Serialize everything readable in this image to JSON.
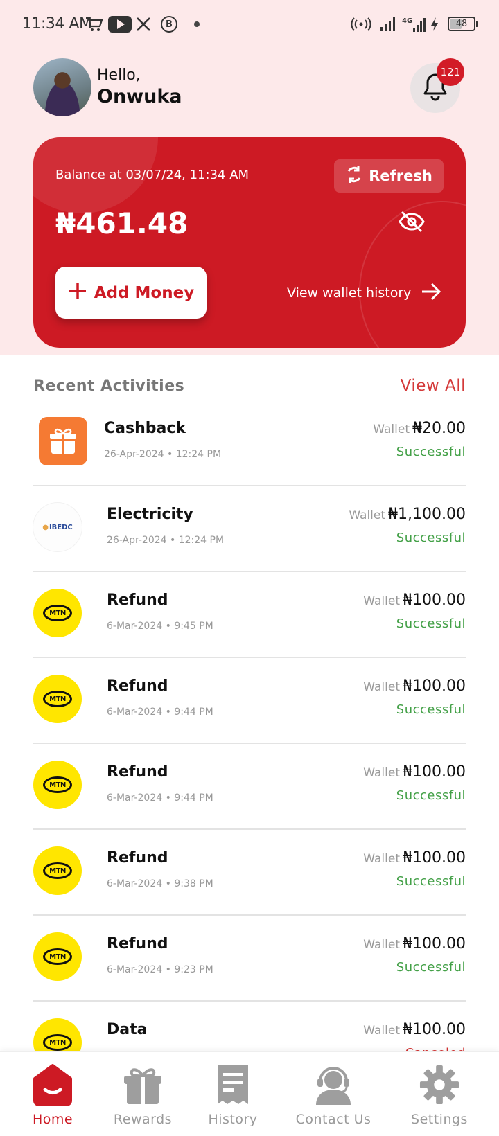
{
  "status_bar": {
    "time": "11:34 AM",
    "battery": "48",
    "network": "4G"
  },
  "header": {
    "greeting": "Hello,",
    "name": "Onwuka",
    "notification_count": "121"
  },
  "balance_card": {
    "label": "Balance at 03/07/24, 11:34 AM",
    "refresh_label": "Refresh",
    "amount": "₦461.48",
    "add_money_label": "Add Money",
    "history_link_label": "View wallet history"
  },
  "recent": {
    "title": "Recent Activities",
    "view_all_label": "View All",
    "items": [
      {
        "title": "Cashback",
        "date": "26-Apr-2024 • 12:24 PM",
        "source": "Wallet",
        "amount": "₦20.00",
        "status": "Successful",
        "logo": "gift-icon"
      },
      {
        "title": "Electricity",
        "date": "26-Apr-2024 • 12:24 PM",
        "source": "Wallet",
        "amount": "₦1,100.00",
        "status": "Successful",
        "logo": "ibedc-logo",
        "logo_text": "IBEDC"
      },
      {
        "title": "Refund",
        "date": "6-Mar-2024 • 9:45 PM",
        "source": "Wallet",
        "amount": "₦100.00",
        "status": "Successful",
        "logo": "mtn-logo",
        "logo_text": "MTN"
      },
      {
        "title": "Refund",
        "date": "6-Mar-2024 • 9:44 PM",
        "source": "Wallet",
        "amount": "₦100.00",
        "status": "Successful",
        "logo": "mtn-logo",
        "logo_text": "MTN"
      },
      {
        "title": "Refund",
        "date": "6-Mar-2024 • 9:44 PM",
        "source": "Wallet",
        "amount": "₦100.00",
        "status": "Successful",
        "logo": "mtn-logo",
        "logo_text": "MTN"
      },
      {
        "title": "Refund",
        "date": "6-Mar-2024 • 9:38 PM",
        "source": "Wallet",
        "amount": "₦100.00",
        "status": "Successful",
        "logo": "mtn-logo",
        "logo_text": "MTN"
      },
      {
        "title": "Refund",
        "date": "6-Mar-2024 • 9:23 PM",
        "source": "Wallet",
        "amount": "₦100.00",
        "status": "Successful",
        "logo": "mtn-logo",
        "logo_text": "MTN"
      },
      {
        "title": "Data",
        "date": "",
        "source": "Wallet",
        "amount": "₦100.00",
        "status": "Canceled",
        "logo": "mtn-logo",
        "logo_text": "MTN"
      }
    ]
  },
  "bottom_nav": {
    "items": [
      {
        "label": "Home",
        "icon": "home-icon",
        "active": true
      },
      {
        "label": "Rewards",
        "icon": "gift-icon"
      },
      {
        "label": "History",
        "icon": "receipt-icon"
      },
      {
        "label": "Contact Us",
        "icon": "headset-icon"
      },
      {
        "label": "Settings",
        "icon": "gear-icon"
      }
    ]
  },
  "colors": {
    "brand_red": "#cd1a24",
    "success": "#43a047",
    "cancel": "#d32f2f",
    "top_bg": "#fde9ea"
  }
}
